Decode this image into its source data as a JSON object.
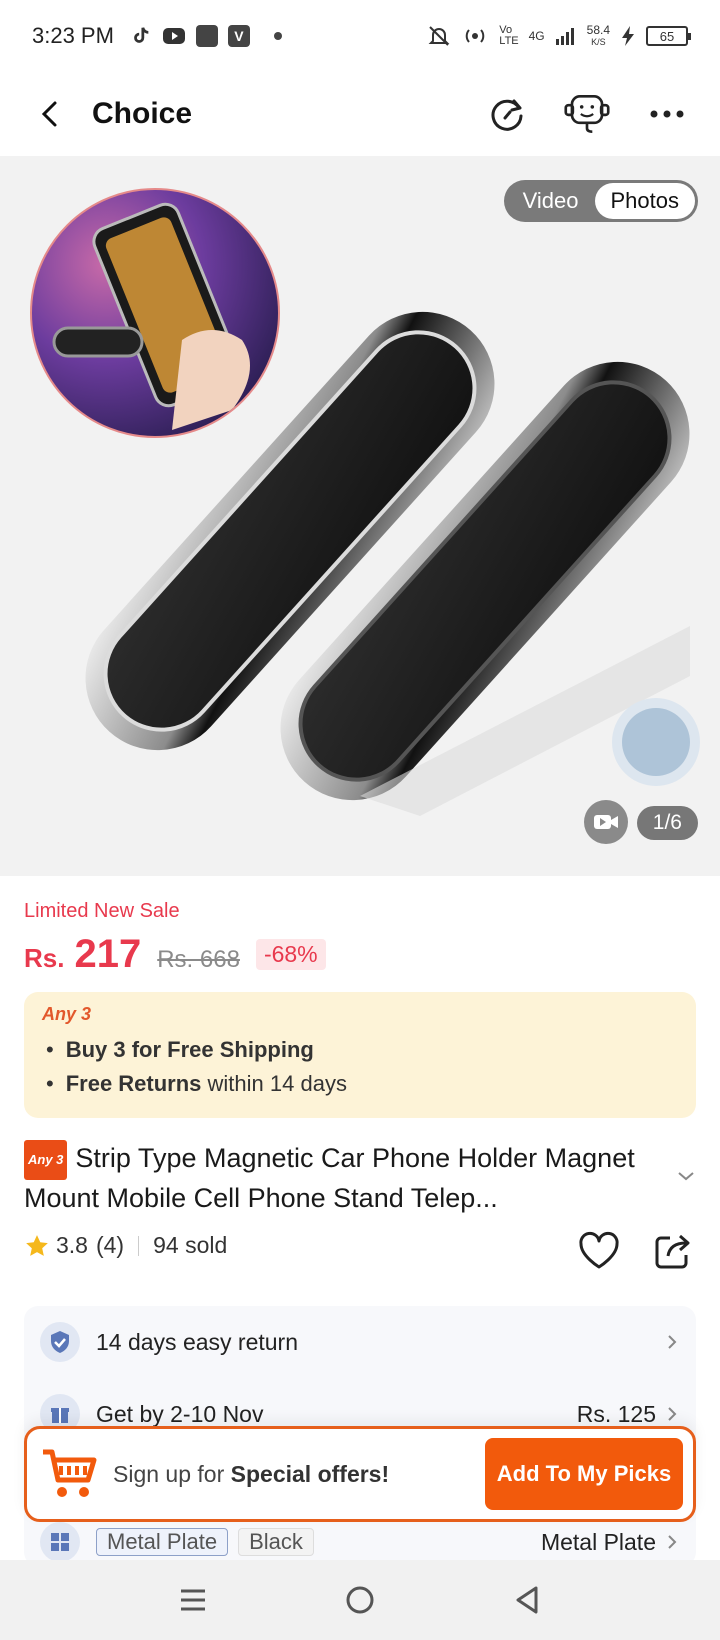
{
  "status_bar": {
    "time": "3:23 PM",
    "network_speed": "58.4",
    "network_speed_unit": "K/S",
    "network_label_1": "Vo",
    "network_label_2": "LTE",
    "network_gen": "4G",
    "battery": "65"
  },
  "header": {
    "title": "Choice"
  },
  "gallery": {
    "toggle_video": "Video",
    "toggle_photos": "Photos",
    "counter": "1/6"
  },
  "price": {
    "sale_label": "Limited New Sale",
    "currency": "Rs.",
    "current": "217",
    "original": "Rs. 668",
    "discount": "-68%"
  },
  "promo": {
    "tag": "Any 3",
    "line1_bold": "Buy 3 for  Free Shipping",
    "line2_bold": "Free Returns",
    "line2_rest": " within 14 days"
  },
  "product": {
    "badge": "Any 3",
    "title": "Strip Type Magnetic Car Phone Holder Magnet Mount Mobile Cell Phone Stand Telep...",
    "rating": "3.8",
    "reviews": "(4)",
    "sold": "94 sold"
  },
  "services": {
    "return_label": "14 days easy return",
    "delivery_label": "Get by 2-10 Nov",
    "delivery_price": "Rs. 125",
    "variant_chip_1": "Metal Plate",
    "variant_chip_2": "Black",
    "variant_value": "Metal Plate"
  },
  "signup": {
    "text_prefix": "Sign up for ",
    "text_bold": "Special offers!",
    "button": "Add To My Picks"
  },
  "colors": {
    "accent": "#f25a0c",
    "price_red": "#e8394d",
    "promo_bg": "#fdf3d7"
  }
}
